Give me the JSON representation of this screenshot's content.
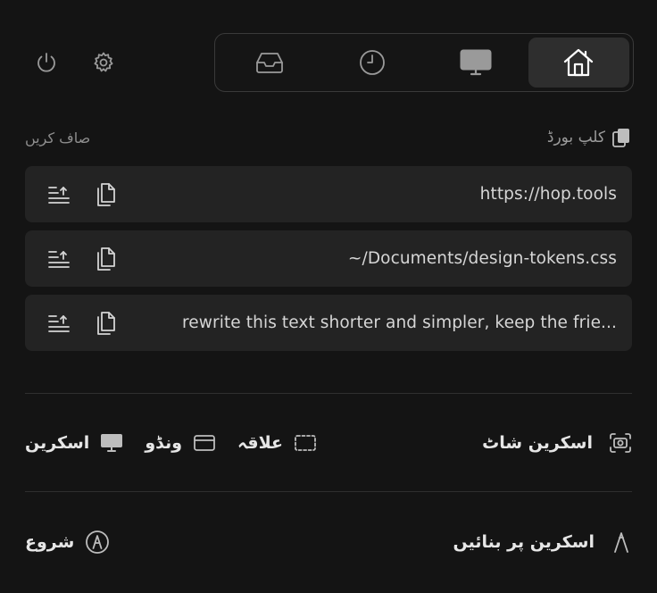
{
  "toolbar": {
    "power_icon": "power-icon",
    "settings_icon": "gear-icon",
    "tabs": [
      {
        "name": "inbox",
        "icon": "inbox-icon",
        "active": false
      },
      {
        "name": "history",
        "icon": "clock-icon",
        "active": false
      },
      {
        "name": "display",
        "icon": "monitor-icon",
        "active": false
      },
      {
        "name": "home",
        "icon": "home-icon",
        "active": true
      }
    ]
  },
  "clipboard": {
    "title": "کلپ بورڈ",
    "clear_label": "صاف کریں",
    "items": [
      {
        "text": "https://hop.tools"
      },
      {
        "text": "~/Documents/design-tokens.css"
      },
      {
        "text": "rewrite this text shorter and simpler, keep the frie..."
      }
    ]
  },
  "screenshot": {
    "title": "اسکرین شاٹ",
    "options": {
      "screen": "اسکرین",
      "window": "ونڈو",
      "area": "علاقہ"
    }
  },
  "recording": {
    "title": "اسکرین پر بنائیں",
    "start_label": "شروع"
  },
  "colors": {
    "background": "#141414",
    "row_background": "#232323",
    "active_tab": "#2e2e2e"
  }
}
